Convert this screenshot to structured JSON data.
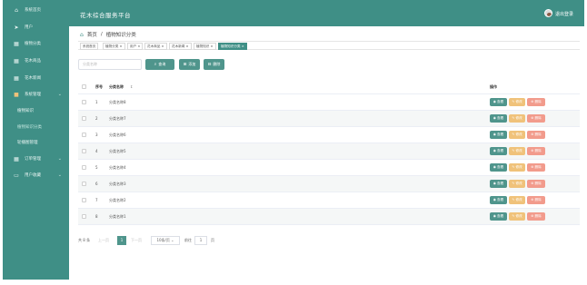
{
  "app": {
    "title": "花木综合服务平台",
    "logout": "退出登录"
  },
  "sidebar": {
    "items": [
      {
        "icon": "⌂",
        "label": "系统首页"
      },
      {
        "icon": "➤",
        "label": "用户"
      },
      {
        "icon": "▦",
        "label": "植物分类"
      },
      {
        "icon": "▦",
        "label": "花木商品"
      },
      {
        "icon": "▦",
        "label": "花木新闻"
      },
      {
        "icon": "■",
        "label": "系统管理",
        "arrow": "⌄"
      },
      {
        "label": "植物知识"
      },
      {
        "label": "植物知识分类"
      },
      {
        "label": "轮播图管理"
      },
      {
        "icon": "▦",
        "label": "订单管理",
        "arrow": "⌄"
      },
      {
        "icon": "▭",
        "label": "用户收藏",
        "arrow": "⌄"
      }
    ]
  },
  "breadcrumb": {
    "home": "首页",
    "sep": "/",
    "current": "植物知识分类"
  },
  "tags": [
    "系统首页",
    "植物分类 ×",
    "用户 ×",
    "花木商品 ×",
    "花木新闻 ×",
    "植物知识 ×",
    "植物知识分类 ×"
  ],
  "toolbar": {
    "search_placeholder": "分类名称",
    "query": "查询",
    "add": "添加",
    "delete": "删除"
  },
  "table": {
    "headers": {
      "index": "序号",
      "name": "分类名称",
      "sort": "↕",
      "ops": "操作"
    },
    "rows": [
      {
        "index": "1",
        "name": "分类名称8"
      },
      {
        "index": "2",
        "name": "分类名称7"
      },
      {
        "index": "3",
        "name": "分类名称6"
      },
      {
        "index": "4",
        "name": "分类名称5"
      },
      {
        "index": "5",
        "name": "分类名称4"
      },
      {
        "index": "6",
        "name": "分类名称3"
      },
      {
        "index": "7",
        "name": "分类名称2"
      },
      {
        "index": "8",
        "name": "分类名称1"
      }
    ],
    "actions": {
      "view": "◉ 查看",
      "edit": "✎ 修改",
      "del": "⊗ 删除"
    }
  },
  "pagination": {
    "total": "共 8 条",
    "prev": "上一页",
    "page": "1",
    "next": "下一页",
    "page_size": "10条/页 ⌄",
    "goto_label": "前往",
    "goto_value": "1",
    "goto_suffix": "页"
  }
}
